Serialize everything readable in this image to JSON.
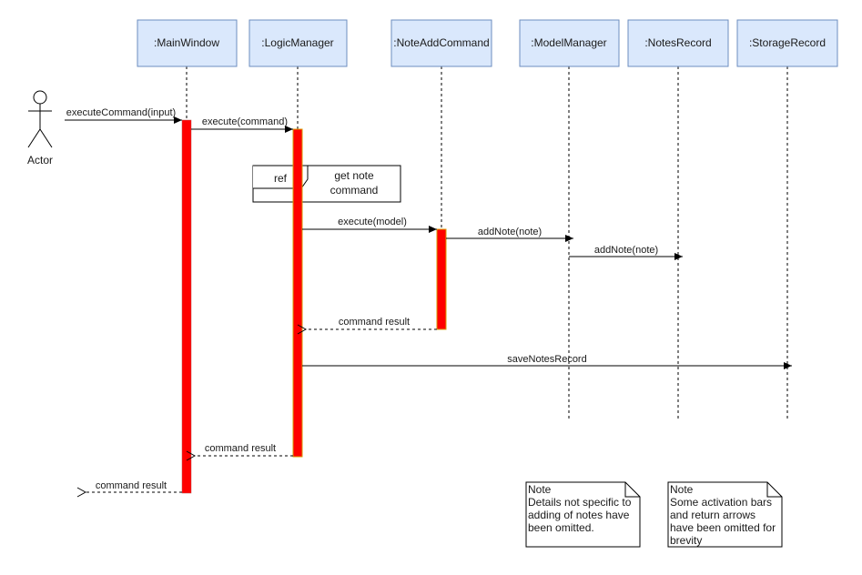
{
  "diagram": {
    "type": "sequence",
    "actor": {
      "label": "Actor"
    },
    "lifelines": [
      {
        "id": "mainwindow",
        "label": ":MainWindow"
      },
      {
        "id": "logicmanager",
        "label": ":LogicManager"
      },
      {
        "id": "noteaddcommand",
        "label": ":NoteAddCommand"
      },
      {
        "id": "modelmanager",
        "label": ":ModelManager"
      },
      {
        "id": "notesrecord",
        "label": ":NotesRecord"
      },
      {
        "id": "storagerecord",
        "label": ":StorageRecord"
      }
    ],
    "messages": [
      {
        "from": "actor",
        "to": "mainwindow",
        "label": "executeCommand(input)",
        "kind": "sync"
      },
      {
        "from": "mainwindow",
        "to": "logicmanager",
        "label": "execute(command)",
        "kind": "sync"
      },
      {
        "from": "logicmanager",
        "to": "noteaddcommand",
        "label": "execute(model)",
        "kind": "sync"
      },
      {
        "from": "noteaddcommand",
        "to": "modelmanager",
        "label": "addNote(note)",
        "kind": "sync"
      },
      {
        "from": "modelmanager",
        "to": "notesrecord",
        "label": "addNote(note)",
        "kind": "sync"
      },
      {
        "from": "noteaddcommand",
        "to": "logicmanager",
        "label": "command result",
        "kind": "return"
      },
      {
        "from": "logicmanager",
        "to": "storagerecord",
        "label": "saveNotesRecord",
        "kind": "sync"
      },
      {
        "from": "logicmanager",
        "to": "mainwindow",
        "label": "command result",
        "kind": "return"
      },
      {
        "from": "mainwindow",
        "to": "actor",
        "label": "command result",
        "kind": "return"
      }
    ],
    "ref": {
      "tag": "ref",
      "label_line1": "get note",
      "label_line2": "command"
    },
    "notes": [
      {
        "title": "Note",
        "lines": [
          "Details not specific to",
          "adding of notes have",
          "been omitted."
        ]
      },
      {
        "title": "Note",
        "lines": [
          "Some activation bars",
          "and return arrows",
          "have been omitted for",
          "brevity"
        ]
      }
    ],
    "colors": {
      "lifeline_fill": "#dae8fc",
      "lifeline_stroke": "#6c8ebf",
      "activation_fill": "#ff0000",
      "activation_stroke": "#d79b00"
    }
  }
}
